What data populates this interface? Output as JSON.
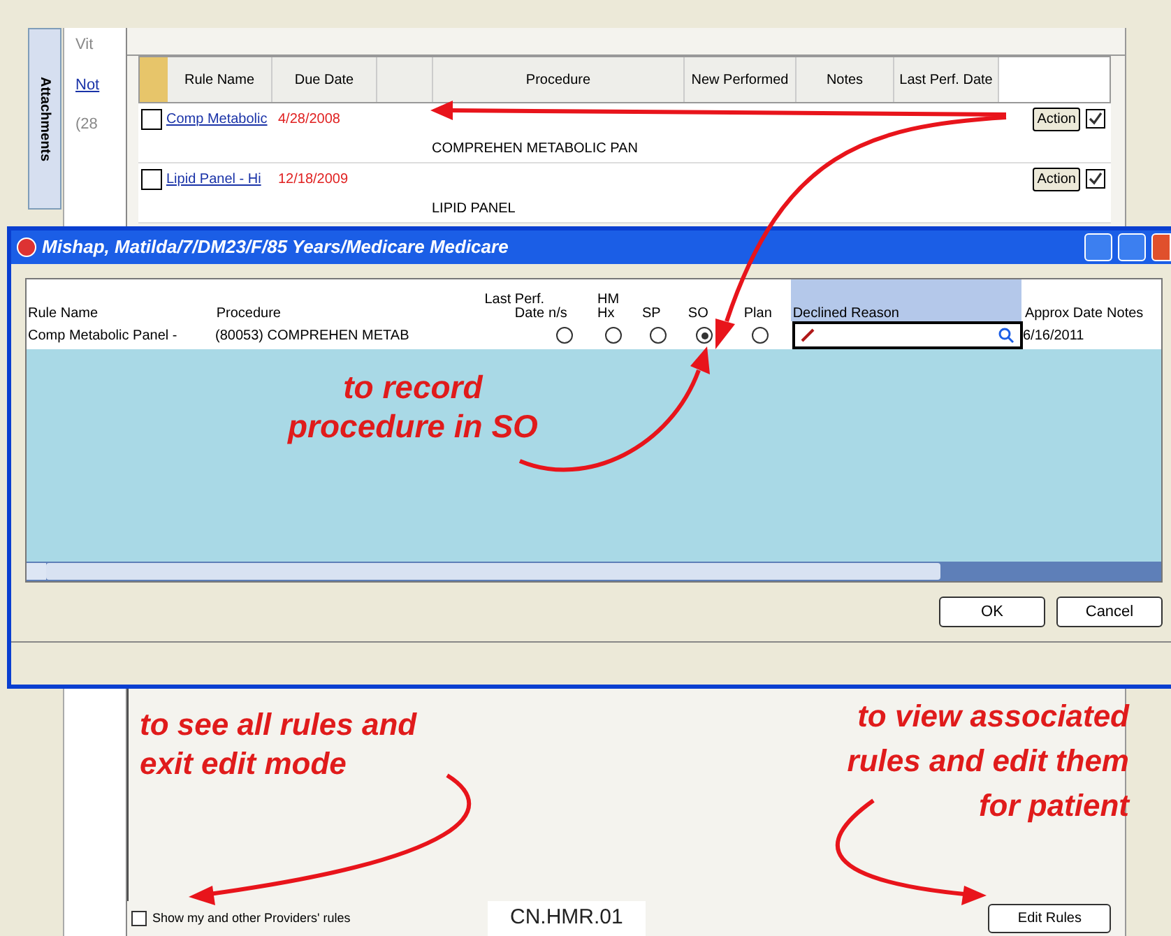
{
  "background_panel": {
    "side_tab": "Attachments",
    "side_items": [
      "Vit",
      "Not",
      "(28"
    ],
    "columns": [
      "Rule Name",
      "Due Date",
      "Procedure",
      "New Performed",
      "Notes",
      "Last Perf. Date"
    ],
    "rows": [
      {
        "rule_name": "Comp Metabolic",
        "due_date": "4/28/2008",
        "procedure": "COMPREHEN METABOLIC PAN",
        "checked": false,
        "action": "Action"
      },
      {
        "rule_name": "Lipid Panel - Hi",
        "due_date": "12/18/2009",
        "procedure": "LIPID PANEL",
        "checked": false,
        "action": "Action"
      }
    ]
  },
  "dialog": {
    "title": "Mishap, Matilda/7/DM23/F/85 Years/Medicare Medicare",
    "columns": [
      {
        "label": "Rule Name",
        "selected": false
      },
      {
        "label": "Procedure",
        "selected": false
      },
      {
        "label": "Last Perf. Date",
        "selected": false
      },
      {
        "label": "n/s",
        "selected": false
      },
      {
        "label": "HM Hx",
        "selected": false
      },
      {
        "label": "SP",
        "selected": false
      },
      {
        "label": "SO",
        "selected": false
      },
      {
        "label": "Plan",
        "selected": false
      },
      {
        "label": "Declined Reason",
        "selected": true
      },
      {
        "label": "Approx Date",
        "selected": false
      },
      {
        "label": "Notes",
        "selected": false
      }
    ],
    "rows": [
      {
        "rule_name": "Comp Metabolic Panel -",
        "procedure": "(80053) COMPREHEN METAB",
        "options": [
          {
            "selected": false
          },
          {
            "selected": false
          },
          {
            "selected": false
          },
          {
            "selected": true
          },
          {
            "selected": false
          }
        ],
        "approx_date": "6/16/2011"
      }
    ],
    "buttons": [
      "OK",
      "Cancel"
    ]
  },
  "footer": {
    "checkbox": {
      "label": "Show my and other Providers' rules",
      "checked": false
    },
    "code": "CN.HMR.01",
    "button": "Edit Rules"
  },
  "annotations": [
    "to record\nprocedure in SO",
    "to see all rules and\nexit edit mode",
    "to view associated\nrules and edit them\nfor patient"
  ]
}
